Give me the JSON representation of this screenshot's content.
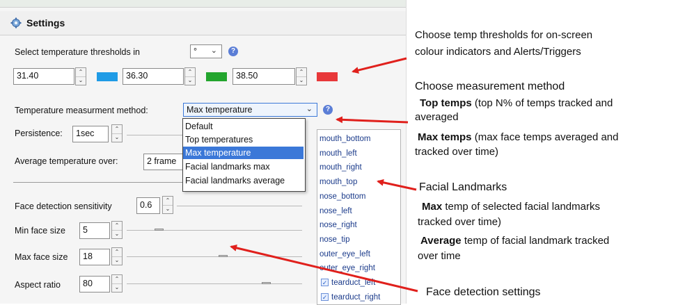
{
  "settings": {
    "title": "Settings",
    "threshold_label": "Select temperature thresholds in",
    "unit_value": "°",
    "thresholds": [
      {
        "value": "31.40",
        "color": "#1f9be6"
      },
      {
        "value": "36.30",
        "color": "#23a52e"
      },
      {
        "value": "38.50",
        "color": "#e8383a"
      }
    ],
    "method_label": "Temperature measurment method:",
    "method_value": "Max temperature",
    "method_options": [
      "Default",
      "Top temperatures",
      "Max temperature",
      "Facial landmarks max",
      "Facial landmarks average"
    ],
    "persistence_label": "Persistence:",
    "persistence_value": "1sec",
    "average_label": "Average temperature over:",
    "average_value": "2 frame",
    "sensitivity_label": "Face detection sensitivity",
    "sensitivity_value": "0.6",
    "min_face_label": "Min face size",
    "min_face_value": "5",
    "max_face_label": "Max face size",
    "max_face_value": "18",
    "aspect_label": "Aspect ratio",
    "aspect_value": "80"
  },
  "landmarks": [
    {
      "name": "mouth_bottom",
      "checked": false
    },
    {
      "name": "mouth_left",
      "checked": false
    },
    {
      "name": "mouth_right",
      "checked": false
    },
    {
      "name": "mouth_top",
      "checked": false
    },
    {
      "name": "nose_bottom",
      "checked": false
    },
    {
      "name": "nose_left",
      "checked": false
    },
    {
      "name": "nose_right",
      "checked": false
    },
    {
      "name": "nose_tip",
      "checked": false
    },
    {
      "name": "outer_eye_left",
      "checked": false
    },
    {
      "name": "outer_eye_right",
      "checked": false
    },
    {
      "name": "tearduct_left",
      "checked": true
    },
    {
      "name": "tearduct_right",
      "checked": true
    }
  ],
  "annotations": {
    "thresholds_line1": "Choose temp thresholds for on-screen",
    "thresholds_line2": "colour indicators and Alerts/Triggers",
    "method_heading": "Choose measurement method",
    "top_bold": "Top temps",
    "top_rest": " (top N% of temps tracked and",
    "top_line2": "averaged",
    "max_bold": "Max temps",
    "max_rest": " (max face temps averaged and",
    "max_line2": "tracked over time)",
    "landmarks_heading": "Facial Landmarks",
    "lm_max_bold": "Max",
    "lm_max_rest": " temp of selected facial landmarks",
    "lm_max_line2": "tracked over time)",
    "lm_avg_bold": "Average",
    "lm_avg_rest": " temp of facial landmark tracked",
    "lm_avg_line2": "over time",
    "face_detection": "Face detection settings"
  },
  "colors": {
    "arrow": "#e0201c",
    "selection": "#3b78d8"
  }
}
